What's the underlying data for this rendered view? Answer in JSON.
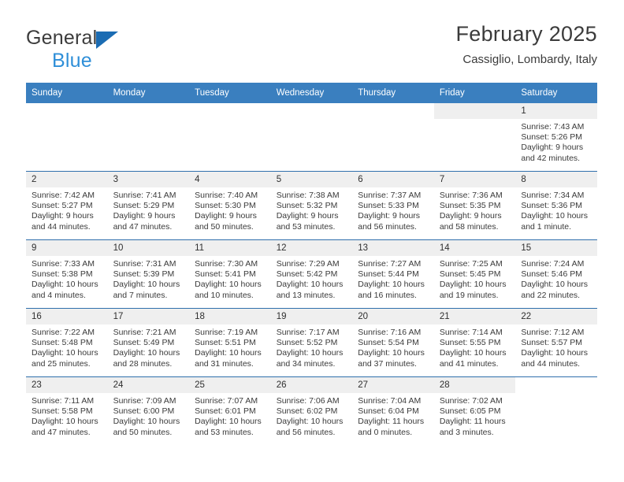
{
  "brand": {
    "word1": "General",
    "word2": "Blue",
    "triangle_color": "#1b6cb3",
    "word1_color": "#3c3c3c",
    "word2_color": "#2f8fd8"
  },
  "header": {
    "title": "February 2025",
    "subtitle": "Cassiglio, Lombardy, Italy"
  },
  "theme": {
    "header_blue": "#3a7fbf",
    "rule_blue": "#2f6fac",
    "daynum_bg": "#efefef",
    "text": "#3a3a3a"
  },
  "calendar": {
    "weekdays": [
      "Sunday",
      "Monday",
      "Tuesday",
      "Wednesday",
      "Thursday",
      "Friday",
      "Saturday"
    ],
    "labels": {
      "sunrise": "Sunrise:",
      "sunset": "Sunset:",
      "daylight": "Daylight:"
    },
    "weeks": [
      [
        {
          "day": "",
          "blank": true
        },
        {
          "day": "",
          "blank": true
        },
        {
          "day": "",
          "blank": true
        },
        {
          "day": "",
          "blank": true
        },
        {
          "day": "",
          "blank": true
        },
        {
          "day": "",
          "empty": true
        },
        {
          "day": "1",
          "sunrise": "Sunrise: 7:43 AM",
          "sunset": "Sunset: 5:26 PM",
          "daylight": "Daylight: 9 hours and 42 minutes."
        }
      ],
      [
        {
          "day": "2",
          "sunrise": "Sunrise: 7:42 AM",
          "sunset": "Sunset: 5:27 PM",
          "daylight": "Daylight: 9 hours and 44 minutes."
        },
        {
          "day": "3",
          "sunrise": "Sunrise: 7:41 AM",
          "sunset": "Sunset: 5:29 PM",
          "daylight": "Daylight: 9 hours and 47 minutes."
        },
        {
          "day": "4",
          "sunrise": "Sunrise: 7:40 AM",
          "sunset": "Sunset: 5:30 PM",
          "daylight": "Daylight: 9 hours and 50 minutes."
        },
        {
          "day": "5",
          "sunrise": "Sunrise: 7:38 AM",
          "sunset": "Sunset: 5:32 PM",
          "daylight": "Daylight: 9 hours and 53 minutes."
        },
        {
          "day": "6",
          "sunrise": "Sunrise: 7:37 AM",
          "sunset": "Sunset: 5:33 PM",
          "daylight": "Daylight: 9 hours and 56 minutes."
        },
        {
          "day": "7",
          "sunrise": "Sunrise: 7:36 AM",
          "sunset": "Sunset: 5:35 PM",
          "daylight": "Daylight: 9 hours and 58 minutes."
        },
        {
          "day": "8",
          "sunrise": "Sunrise: 7:34 AM",
          "sunset": "Sunset: 5:36 PM",
          "daylight": "Daylight: 10 hours and 1 minute."
        }
      ],
      [
        {
          "day": "9",
          "sunrise": "Sunrise: 7:33 AM",
          "sunset": "Sunset: 5:38 PM",
          "daylight": "Daylight: 10 hours and 4 minutes."
        },
        {
          "day": "10",
          "sunrise": "Sunrise: 7:31 AM",
          "sunset": "Sunset: 5:39 PM",
          "daylight": "Daylight: 10 hours and 7 minutes."
        },
        {
          "day": "11",
          "sunrise": "Sunrise: 7:30 AM",
          "sunset": "Sunset: 5:41 PM",
          "daylight": "Daylight: 10 hours and 10 minutes."
        },
        {
          "day": "12",
          "sunrise": "Sunrise: 7:29 AM",
          "sunset": "Sunset: 5:42 PM",
          "daylight": "Daylight: 10 hours and 13 minutes."
        },
        {
          "day": "13",
          "sunrise": "Sunrise: 7:27 AM",
          "sunset": "Sunset: 5:44 PM",
          "daylight": "Daylight: 10 hours and 16 minutes."
        },
        {
          "day": "14",
          "sunrise": "Sunrise: 7:25 AM",
          "sunset": "Sunset: 5:45 PM",
          "daylight": "Daylight: 10 hours and 19 minutes."
        },
        {
          "day": "15",
          "sunrise": "Sunrise: 7:24 AM",
          "sunset": "Sunset: 5:46 PM",
          "daylight": "Daylight: 10 hours and 22 minutes."
        }
      ],
      [
        {
          "day": "16",
          "sunrise": "Sunrise: 7:22 AM",
          "sunset": "Sunset: 5:48 PM",
          "daylight": "Daylight: 10 hours and 25 minutes."
        },
        {
          "day": "17",
          "sunrise": "Sunrise: 7:21 AM",
          "sunset": "Sunset: 5:49 PM",
          "daylight": "Daylight: 10 hours and 28 minutes."
        },
        {
          "day": "18",
          "sunrise": "Sunrise: 7:19 AM",
          "sunset": "Sunset: 5:51 PM",
          "daylight": "Daylight: 10 hours and 31 minutes."
        },
        {
          "day": "19",
          "sunrise": "Sunrise: 7:17 AM",
          "sunset": "Sunset: 5:52 PM",
          "daylight": "Daylight: 10 hours and 34 minutes."
        },
        {
          "day": "20",
          "sunrise": "Sunrise: 7:16 AM",
          "sunset": "Sunset: 5:54 PM",
          "daylight": "Daylight: 10 hours and 37 minutes."
        },
        {
          "day": "21",
          "sunrise": "Sunrise: 7:14 AM",
          "sunset": "Sunset: 5:55 PM",
          "daylight": "Daylight: 10 hours and 41 minutes."
        },
        {
          "day": "22",
          "sunrise": "Sunrise: 7:12 AM",
          "sunset": "Sunset: 5:57 PM",
          "daylight": "Daylight: 10 hours and 44 minutes."
        }
      ],
      [
        {
          "day": "23",
          "sunrise": "Sunrise: 7:11 AM",
          "sunset": "Sunset: 5:58 PM",
          "daylight": "Daylight: 10 hours and 47 minutes."
        },
        {
          "day": "24",
          "sunrise": "Sunrise: 7:09 AM",
          "sunset": "Sunset: 6:00 PM",
          "daylight": "Daylight: 10 hours and 50 minutes."
        },
        {
          "day": "25",
          "sunrise": "Sunrise: 7:07 AM",
          "sunset": "Sunset: 6:01 PM",
          "daylight": "Daylight: 10 hours and 53 minutes."
        },
        {
          "day": "26",
          "sunrise": "Sunrise: 7:06 AM",
          "sunset": "Sunset: 6:02 PM",
          "daylight": "Daylight: 10 hours and 56 minutes."
        },
        {
          "day": "27",
          "sunrise": "Sunrise: 7:04 AM",
          "sunset": "Sunset: 6:04 PM",
          "daylight": "Daylight: 11 hours and 0 minutes."
        },
        {
          "day": "28",
          "sunrise": "Sunrise: 7:02 AM",
          "sunset": "Sunset: 6:05 PM",
          "daylight": "Daylight: 11 hours and 3 minutes."
        },
        {
          "day": "",
          "blank": true
        }
      ]
    ]
  }
}
